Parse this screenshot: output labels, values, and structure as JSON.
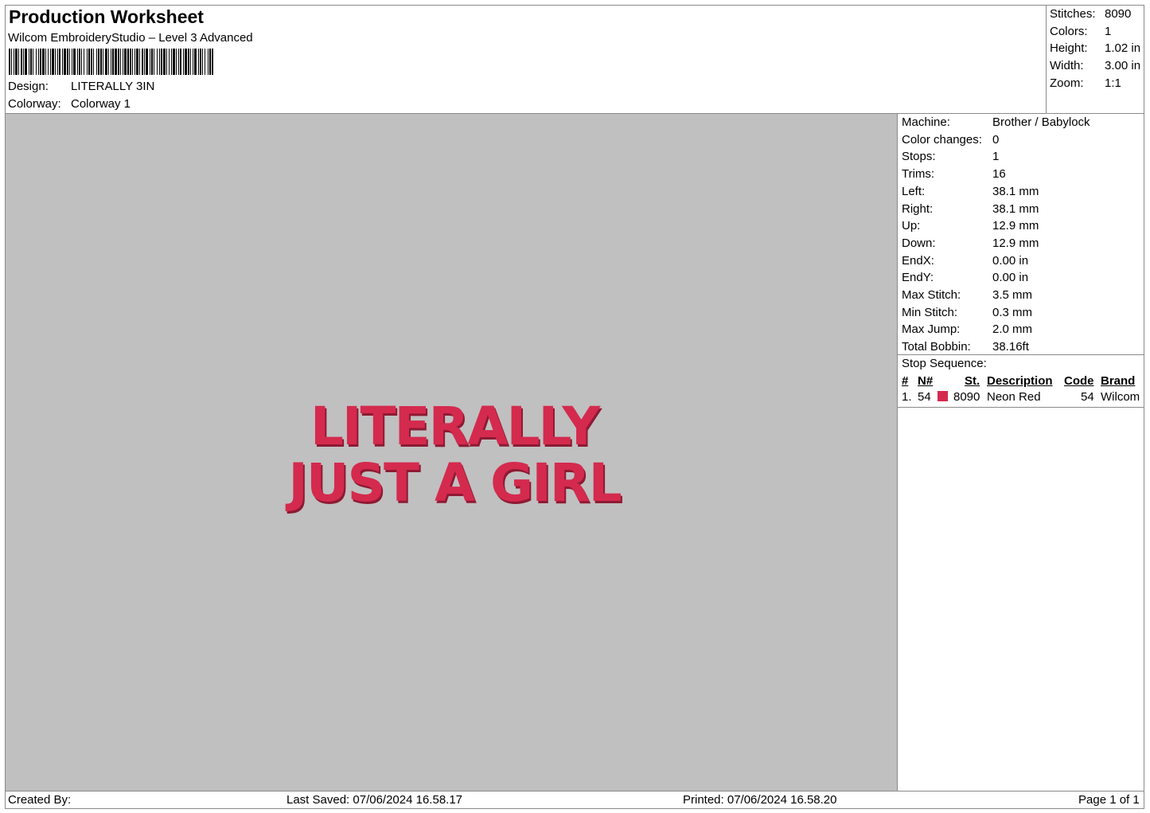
{
  "header": {
    "title": "Production Worksheet",
    "software": "Wilcom EmbroideryStudio – Level 3 Advanced",
    "design_label": "Design:",
    "design_value": "LITERALLY 3IN",
    "colorway_label": "Colorway:",
    "colorway_value": "Colorway 1"
  },
  "stats": {
    "stitches_label": "Stitches:",
    "stitches_value": "8090",
    "colors_label": "Colors:",
    "colors_value": "1",
    "height_label": "Height:",
    "height_value": "1.02 in",
    "width_label": "Width:",
    "width_value": "3.00 in",
    "zoom_label": "Zoom:",
    "zoom_value": "1:1"
  },
  "design": {
    "line1": "LITERALLY",
    "line2": "JUST A GIRL",
    "thread_color": "#d42a4e",
    "canvas_color": "#c0c0c0"
  },
  "machine_info": [
    {
      "label": "Machine:",
      "value": "Brother / Babylock"
    },
    {
      "label": "Color changes:",
      "value": "0"
    },
    {
      "label": "Stops:",
      "value": "1"
    },
    {
      "label": "Trims:",
      "value": "16"
    },
    {
      "label": "Left:",
      "value": "38.1 mm"
    },
    {
      "label": "Right:",
      "value": "38.1 mm"
    },
    {
      "label": "Up:",
      "value": "12.9 mm"
    },
    {
      "label": "Down:",
      "value": "12.9 mm"
    },
    {
      "label": "EndX:",
      "value": "0.00 in"
    },
    {
      "label": "EndY:",
      "value": "0.00 in"
    },
    {
      "label": "Max Stitch:",
      "value": "3.5 mm"
    },
    {
      "label": "Min Stitch:",
      "value": "0.3 mm"
    },
    {
      "label": "Max Jump:",
      "value": "2.0 mm"
    },
    {
      "label": "Total Bobbin:",
      "value": "38.16ft"
    }
  ],
  "stop_sequence": {
    "title": "Stop Sequence:",
    "headers": {
      "num": "#",
      "n": "N#",
      "st": "St.",
      "description": "Description",
      "code": "Code",
      "brand": "Brand"
    },
    "rows": [
      {
        "num": "1.",
        "n": "54",
        "color": "#d42a4e",
        "st": "8090",
        "description": "Neon Red",
        "code": "54",
        "brand": "Wilcom"
      }
    ]
  },
  "footer": {
    "created_by": "Created By:",
    "last_saved": "Last Saved: 07/06/2024 16.58.17",
    "printed": "Printed: 07/06/2024 16.58.20",
    "page": "Page 1 of 1"
  }
}
